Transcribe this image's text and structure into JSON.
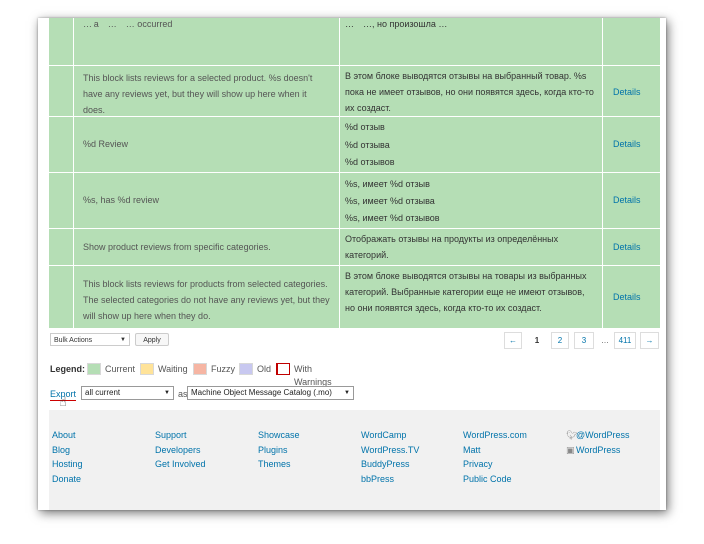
{
  "table": {
    "details_label": "Details",
    "rows": [
      {
        "original": "… a … … occurred",
        "translations": [
          "… …, но произошла …"
        ],
        "show_details": false
      },
      {
        "original": "This block lists reviews for a selected product. %s doesn't have any reviews yet, but they will show up here when it does.",
        "translations": [
          "В этом блоке выводятся отзывы на выбранный товар. %s пока не имеет отзывов, но они появятся здесь, когда кто-то их создаст."
        ],
        "show_details": true
      },
      {
        "original": "%d Review",
        "translations": [
          "%d отзыв",
          "%d отзыва",
          "%d отзывов"
        ],
        "show_details": true
      },
      {
        "original": "%s, has %d review",
        "translations": [
          "%s, имеет %d отзыв",
          "%s, имеет %d отзыва",
          "%s, имеет %d отзывов"
        ],
        "show_details": true
      },
      {
        "original": "Show product reviews from specific categories.",
        "translations": [
          "Отображать отзывы на продукты из определённых категорий."
        ],
        "show_details": true
      },
      {
        "original": "This block lists reviews for products from selected categories. The selected categories do not have any reviews yet, but they will show up here when they do.",
        "translations": [
          "В этом блоке выводятся отзывы на товары из выбранных категорий. Выбранные категории еще не имеют отзывов, но они появятся здесь, когда кто-то их создаст."
        ],
        "show_details": true
      }
    ]
  },
  "bulk": {
    "selected": "Bulk Actions",
    "apply_label": "Apply"
  },
  "pagination": {
    "prev": "←",
    "pages": [
      "1",
      "2",
      "3"
    ],
    "ellipsis": "…",
    "last": "411",
    "next": "→",
    "current": "1"
  },
  "legend": {
    "title": "Legend:",
    "items": [
      {
        "label": "Current",
        "color": "#b5deb5"
      },
      {
        "label": "Waiting",
        "color": "#ffe399"
      },
      {
        "label": "Fuzzy",
        "color": "#f6b5a3"
      },
      {
        "label": "Old",
        "color": "#c8c8f0"
      },
      {
        "label": "With Warnings",
        "color": "#ffffff",
        "border": "#c00000"
      }
    ]
  },
  "export": {
    "link": "Export",
    "filter": "all current",
    "as": "as",
    "format": "Machine Object Message Catalog (.mo)"
  },
  "footer": {
    "columns": [
      [
        "About",
        "Blog",
        "Hosting",
        "Donate"
      ],
      [
        "Support",
        "Developers",
        "Get Involved"
      ],
      [
        "Showcase",
        "Plugins",
        "Themes"
      ],
      [
        "WordCamp",
        "WordPress.TV",
        "BuddyPress",
        "bbPress"
      ],
      [
        "WordPress.com",
        "Matt",
        "Privacy",
        "Public Code"
      ],
      [
        "@WordPress",
        "WordPress"
      ]
    ],
    "social_icons": [
      "twitter-icon",
      "facebook-icon"
    ]
  },
  "colors": {
    "current": "#b5deb5",
    "link": "#0073aa",
    "footer_bg": "#f1f1f1"
  }
}
